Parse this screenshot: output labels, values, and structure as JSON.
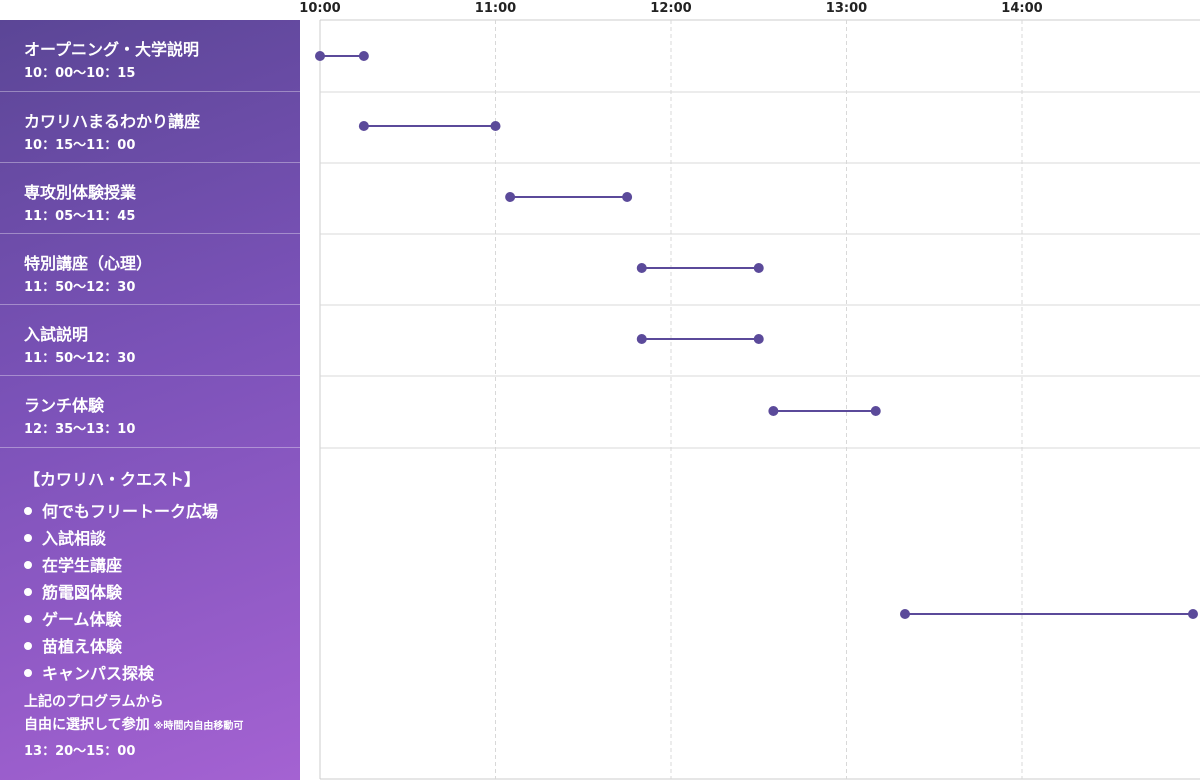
{
  "colors": {
    "accent": "#5b4a9a",
    "sidebar_start": "#5b4696",
    "sidebar_end": "#a462d2",
    "grid": "#d8d8d8"
  },
  "rows": [
    {
      "title": "オープニング・大学説明",
      "time": "10：00〜10：15"
    },
    {
      "title": "カワリハまるわかり講座",
      "time": "10：15〜11：00"
    },
    {
      "title": "専攻別体験授業",
      "time": "11：05〜11：45"
    },
    {
      "title": "特別講座（心理）",
      "time": "11：50〜12：30"
    },
    {
      "title": "入試説明",
      "time": "11：50〜12：30"
    },
    {
      "title": "ランチ体験",
      "time": "12：35〜13：10"
    }
  ],
  "quest": {
    "heading": "【カワリハ・クエスト】",
    "items": [
      "何でもフリートーク広場",
      "入試相談",
      "在学生講座",
      "筋電図体験",
      "ゲーム体験",
      "苗植え体験",
      "キャンパス探検"
    ],
    "note_line1": "上記のプログラムから",
    "note_line2": "自由に選択して参加",
    "note_small": "※時間内自由移動可",
    "time": "13：20〜15：00"
  },
  "chart_data": {
    "type": "gantt",
    "x_ticks": [
      "10:00",
      "11:00",
      "12:00",
      "13:00",
      "14:00"
    ],
    "x_range_hours": [
      10,
      15
    ],
    "grid": true,
    "series": [
      {
        "start": 10.0,
        "end": 10.25
      },
      {
        "start": 10.25,
        "end": 11.0
      },
      {
        "start": 11.0833,
        "end": 11.75
      },
      {
        "start": 11.8333,
        "end": 12.5
      },
      {
        "start": 11.8333,
        "end": 12.5
      },
      {
        "start": 12.5833,
        "end": 13.1667
      },
      {
        "start": 13.3333,
        "end": 15.0
      }
    ]
  }
}
